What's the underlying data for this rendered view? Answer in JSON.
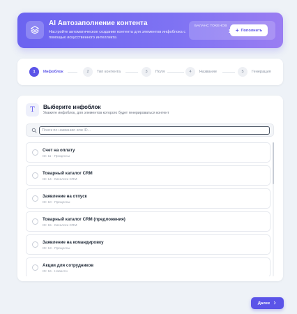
{
  "header": {
    "icon": "layers-icon",
    "title": "AI Автозаполнение контента",
    "description": "Настройте автоматическое создание контента для элементов инфоблока с помощью искусственного интеллекта",
    "balance_label": "Баланс токенов",
    "balance_value": "10 000",
    "replenish_label": "Пополнить"
  },
  "steps": [
    {
      "number": "1",
      "label": "Инфоблок",
      "active": true
    },
    {
      "number": "2",
      "label": "Тип контента",
      "active": false
    },
    {
      "number": "3",
      "label": "Поля",
      "active": false
    },
    {
      "number": "4",
      "label": "Название",
      "active": false
    },
    {
      "number": "5",
      "label": "Генерация",
      "active": false
    }
  ],
  "section": {
    "icon": "T",
    "title": "Выберите инфоблок",
    "subtitle": "Укажите инфоблок, для элементов которого будет генерироваться контент"
  },
  "search": {
    "placeholder": "Поиск по названию или ID..."
  },
  "infoblocks": [
    {
      "name": "Счет на оплату",
      "meta": "ID: 11 · Процессы"
    },
    {
      "name": "Товарный каталог CRM",
      "meta": "ID: 14 · Каталоги CRM"
    },
    {
      "name": "Заявление на отпуск",
      "meta": "ID: 10 · Процессы"
    },
    {
      "name": "Товарный каталог CRM (предложения)",
      "meta": "ID: 15 · Каталоги CRM"
    },
    {
      "name": "Заявление на командировку",
      "meta": "ID: 13 · Процессы"
    },
    {
      "name": "Акции для сотрудников",
      "meta": "ID: 16 · Новости"
    }
  ],
  "footer": {
    "next_label": "Далее"
  },
  "colors": {
    "accent": "#5b54e8",
    "banner_start": "#6b63f0",
    "banner_end": "#9a7df2",
    "background": "#eef2f7"
  }
}
